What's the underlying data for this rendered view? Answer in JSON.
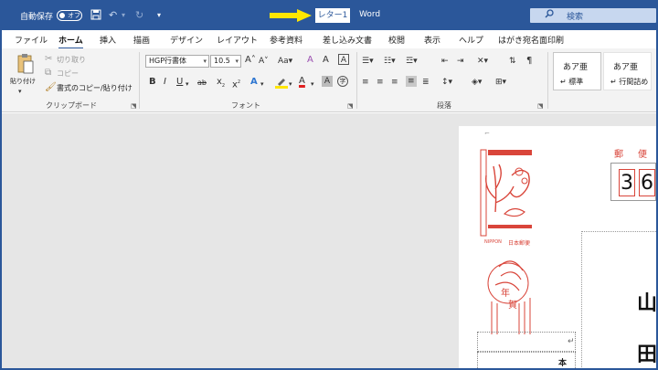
{
  "titlebar": {
    "autosave_label": "自動保存",
    "toggle_state": "オフ",
    "document_name": "レター1",
    "app_name": "Word",
    "search_placeholder": "検索"
  },
  "menu": {
    "tabs": [
      "ファイル",
      "ホーム",
      "挿入",
      "描画",
      "デザイン",
      "レイアウト",
      "参考資料",
      "差し込み文書",
      "校閲",
      "表示",
      "ヘルプ",
      "はがき宛名面印刷"
    ],
    "active_tab": "ホーム"
  },
  "ribbon": {
    "clipboard": {
      "paste_label": "貼り付け",
      "cut_label": "切り取り",
      "copy_label": "コピー",
      "format_painter_label": "書式のコピー/貼り付け",
      "group_label": "クリップボード"
    },
    "font": {
      "font_name": "HGP行書体",
      "font_size": "10.5",
      "grow_label": "A",
      "shrink_label": "A",
      "case_label": "Aa",
      "clear_label": "A",
      "phonetic_label": "A",
      "bold": "B",
      "italic": "I",
      "underline": "U",
      "strike": "ab",
      "subscript": "x",
      "superscript": "x",
      "effects": "A",
      "highlight": "ab",
      "color": "A",
      "shade": "A",
      "enclose": "字",
      "group_label": "フォント"
    },
    "paragraph": {
      "group_label": "段落"
    },
    "styles": {
      "items": [
        {
          "sample": "あア亜",
          "name": "↵ 標準"
        },
        {
          "sample": "あア亜",
          "name": "↵ 行間詰め"
        }
      ]
    }
  },
  "document": {
    "postal_label_1": "郵",
    "postal_label_2": "便",
    "zip_digits": [
      "3",
      "6"
    ],
    "address_chars": [
      "山",
      "田"
    ],
    "stamp_nippon": "NIPPON",
    "stamp_jp": "日本郵便",
    "stamp_nenga_1": "年",
    "stamp_nenga_2": "賀",
    "sender_char": "本"
  },
  "colors": {
    "word_blue": "#2b579a",
    "stamp_red": "#d9453a",
    "arrow_yellow": "#ffe600"
  }
}
